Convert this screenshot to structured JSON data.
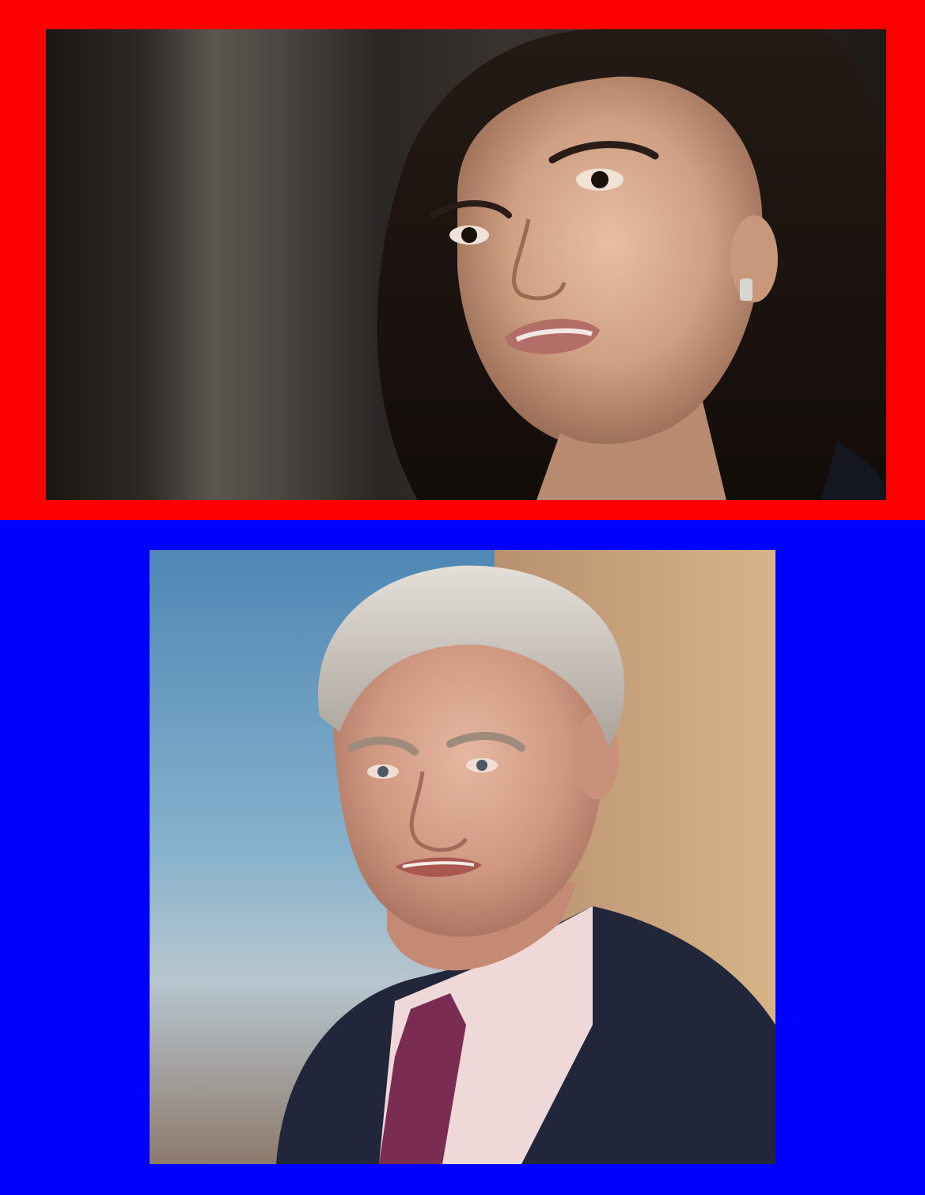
{
  "colors": {
    "top_frame": "#ff0000",
    "bottom_frame": "#0000ff"
  },
  "photos": [
    {
      "subject": "woman-speaking-portrait",
      "frame_color_key": "top_frame"
    },
    {
      "subject": "older-man-smiling-portrait",
      "frame_color_key": "bottom_frame"
    }
  ]
}
